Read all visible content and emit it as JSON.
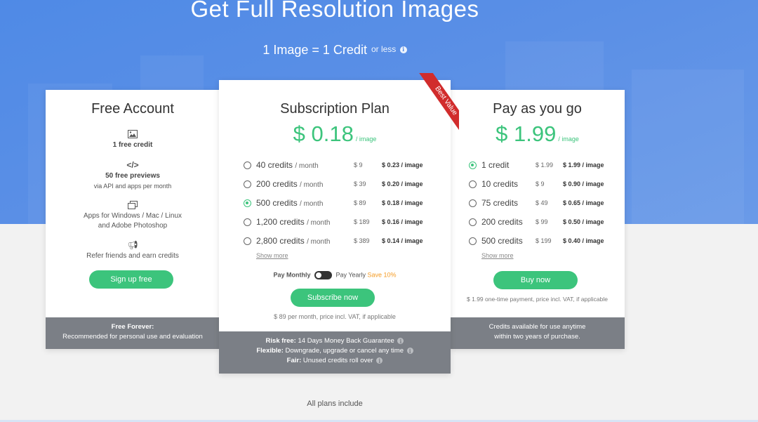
{
  "hero": {
    "title": "Get Full Resolution Images",
    "subtitle": "1 Image = 1 Credit",
    "or_less": "or less"
  },
  "free_card": {
    "title": "Free Account",
    "features": [
      {
        "icon": "image-icon",
        "bold": "1 free credit",
        "text": ""
      },
      {
        "icon": "code-icon",
        "bold": "50 free previews",
        "text": "via API and apps per month"
      },
      {
        "icon": "windows-icon",
        "bold": "",
        "text": "Apps for Windows / Mac / Linux"
      },
      {
        "icon": "",
        "bold": "",
        "text": "and Adobe Photoshop"
      },
      {
        "icon": "megaphone-icon",
        "bold": "",
        "text": "Refer friends and earn credits"
      }
    ],
    "button": "Sign up free",
    "footer_bold": "Free Forever:",
    "footer_text": "Recommended for personal use and evaluation"
  },
  "subscription_card": {
    "ribbon": "Best Value",
    "title": "Subscription Plan",
    "price": "$ 0.18",
    "unit": "/ image",
    "rows": [
      {
        "credits": "40 credits",
        "period": "/ month",
        "amount": "$ 9",
        "per": "$ 0.23 / image",
        "selected": false
      },
      {
        "credits": "200 credits",
        "period": "/ month",
        "amount": "$ 39",
        "per": "$ 0.20 / image",
        "selected": false
      },
      {
        "credits": "500 credits",
        "period": "/ month",
        "amount": "$ 89",
        "per": "$ 0.18 / image",
        "selected": true
      },
      {
        "credits": "1,200 credits",
        "period": "/ month",
        "amount": "$ 189",
        "per": "$ 0.16 / image",
        "selected": false
      },
      {
        "credits": "2,800 credits",
        "period": "/ month",
        "amount": "$ 389",
        "per": "$ 0.14 / image",
        "selected": false
      }
    ],
    "show_more": "Show more",
    "pay_monthly": "Pay Monthly",
    "pay_yearly": "Pay Yearly",
    "save": "Save 10%",
    "button": "Subscribe now",
    "note": "$ 89 per month, price incl. VAT, if applicable",
    "footer": [
      {
        "bold": "Risk free:",
        "text": "14 Days Money Back Guarantee"
      },
      {
        "bold": "Flexible:",
        "text": "Downgrade, upgrade or cancel any time"
      },
      {
        "bold": "Fair:",
        "text": "Unused credits roll over"
      }
    ]
  },
  "payg_card": {
    "title": "Pay as you go",
    "price": "$ 1.99",
    "unit": "/ image",
    "rows": [
      {
        "credits": "1 credit",
        "amount": "$ 1.99",
        "per": "$ 1.99 / image",
        "selected": true
      },
      {
        "credits": "10 credits",
        "amount": "$ 9",
        "per": "$ 0.90 / image",
        "selected": false
      },
      {
        "credits": "75 credits",
        "amount": "$ 49",
        "per": "$ 0.65 / image",
        "selected": false
      },
      {
        "credits": "200 credits",
        "amount": "$ 99",
        "per": "$ 0.50 / image",
        "selected": false
      },
      {
        "credits": "500 credits",
        "amount": "$ 199",
        "per": "$ 0.40 / image",
        "selected": false
      }
    ],
    "show_more": "Show more",
    "button": "Buy now",
    "note": "$ 1.99 one-time payment, price incl. VAT, if applicable",
    "footer_line1": "Credits available for use anytime",
    "footer_line2": "within two years of purchase."
  },
  "all_plans": "All plans include",
  "colors": {
    "accent": "#3cc47c",
    "hero": "#5a8fe6",
    "ribbon": "#d12c2c",
    "footer": "#7b7f86",
    "save": "#f59b23"
  }
}
